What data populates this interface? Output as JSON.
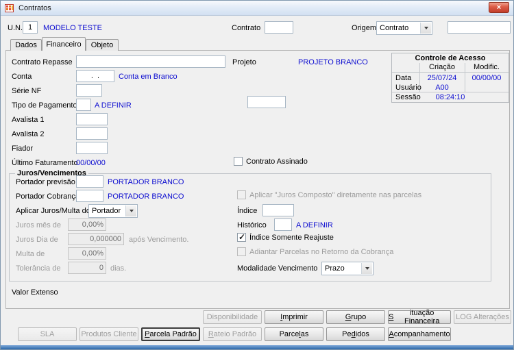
{
  "window": {
    "title": "Contratos"
  },
  "header": {
    "un_label": "U.N.",
    "un_value": "1",
    "un_description": "MODELO TESTE",
    "contrato_label": "Contrato",
    "contrato_value": "",
    "origem_label": "Origem",
    "origem_value": "Contrato",
    "origem_code_value": ""
  },
  "tabs": {
    "dados": "Dados",
    "financeiro": "Financeiro",
    "objeto": "Objeto"
  },
  "fields": {
    "contrato_repasse": {
      "label": "Contrato Repasse",
      "value": ""
    },
    "projeto": {
      "label": "Projeto",
      "value": "PROJETO BRANCO"
    },
    "conta": {
      "label": "Conta",
      "value": ".  .",
      "description": "Conta em Branco"
    },
    "serie_nf": {
      "label": "Série NF",
      "value": ""
    },
    "tipo_pagamento": {
      "label": "Tipo de Pagamento",
      "value": "",
      "description": "A DEFINIR"
    },
    "unlabeled_value": "",
    "avalista1": {
      "label": "Avalista 1",
      "value": ""
    },
    "avalista2": {
      "label": "Avalista 2",
      "value": ""
    },
    "fiador": {
      "label": "Fiador",
      "value": ""
    },
    "ultimo_faturamento": {
      "label": "Último Faturamento",
      "value": "00/00/00"
    },
    "contrato_assinado": {
      "label": "Contrato Assinado",
      "checked": false
    }
  },
  "acesso": {
    "title": "Controle de Acesso",
    "col_criacao": "Criação",
    "col_modific": "Modific.",
    "data_label": "Data",
    "data_criacao": "25/07/24",
    "data_modific": "00/00/00",
    "usuario_label": "Usuário",
    "usuario_value": "A00",
    "sessao_label": "Sessão",
    "sessao_value": "08:24:10"
  },
  "juros": {
    "title": "Juros/Vencimentos",
    "portador_previsao": {
      "label": "Portador previsão",
      "value": "",
      "description": "PORTADOR BRANCO"
    },
    "portador_cobranca": {
      "label": "Portador Cobrança",
      "value": "",
      "description": "PORTADOR BRANCO"
    },
    "juros_composto": {
      "label": "Aplicar \"Juros Composto\" diretamente nas parcelas",
      "checked": false
    },
    "aplicar_juros_multa": {
      "label": "Aplicar Juros/Multa do",
      "value": "Portador"
    },
    "indice": {
      "label": "Índice",
      "value": ""
    },
    "juros_mes": {
      "label": "Juros mês de",
      "value": "0,00%"
    },
    "historico": {
      "label": "Histórico",
      "value": "",
      "description": "A DEFINIR"
    },
    "juros_dia": {
      "label": "Juros Dia de",
      "value": "0,000000",
      "suffix": "após Vencimento."
    },
    "indice_somente_reajuste": {
      "label": "Índice Somente Reajuste",
      "checked": true
    },
    "multa": {
      "label": "Multa de",
      "value": "0,00%"
    },
    "adiantar_parcelas": {
      "label": "Adiantar Parcelas no Retorno da Cobrança",
      "checked": false
    },
    "tolerancia": {
      "label": "Tolerância de",
      "value": "0",
      "suffix": "dias."
    },
    "modalidade_vencimento": {
      "label": "Modalidade Vencimento",
      "value": "Prazo"
    }
  },
  "valor_extenso_label": "Valor Extenso",
  "buttons": {
    "disponibilidade": {
      "label": "Disponibilidade",
      "enabled": false
    },
    "imprimir": {
      "label": "Imprimir",
      "accel": "I",
      "enabled": true
    },
    "grupo": {
      "label": "Grupo",
      "accel": "G",
      "enabled": true
    },
    "situacao_financeira": {
      "label": "Situação Financeira",
      "accel": "S",
      "enabled": true
    },
    "log_alteracoes": {
      "label": "LOG Alterações",
      "enabled": false
    },
    "sla": {
      "label": "SLA",
      "enabled": false
    },
    "produtos_cliente": {
      "label": "Produtos Cliente",
      "enabled": false
    },
    "parcela_padrao": {
      "label": "Parcela Padrão",
      "accel": "P",
      "enabled": true,
      "default": true
    },
    "rateio_padrao": {
      "label": "Rateio Padrão",
      "accel": "R",
      "enabled": false
    },
    "parcelas": {
      "label": "Parcelas",
      "accel": "l",
      "enabled": true
    },
    "pedidos": {
      "label": "Pedidos",
      "accel": "d",
      "enabled": true
    },
    "acompanhamento": {
      "label": "Acompanhamento",
      "accel": "A",
      "enabled": true
    }
  },
  "colors": {
    "link_blue_text": "#0b0bd0",
    "disabled_text": "#9b9b9b",
    "close_button_red": "#c13c28",
    "bottom_strip_blue": "#2b66a8"
  }
}
